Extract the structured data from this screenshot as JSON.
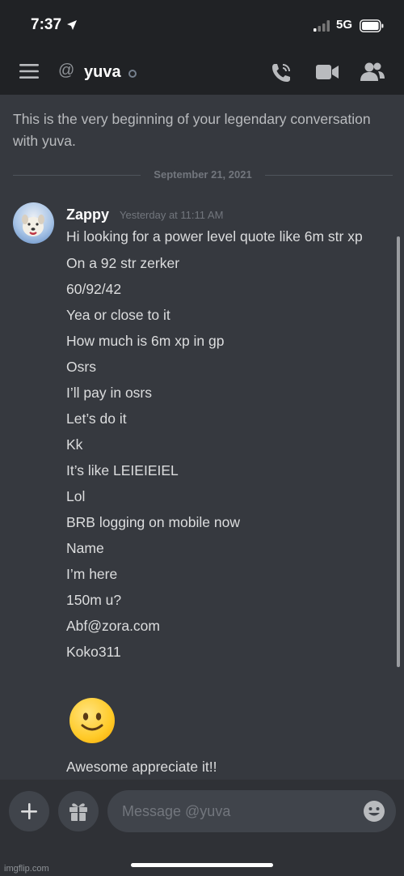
{
  "status_bar": {
    "time": "7:37",
    "network": "5G"
  },
  "header": {
    "channel_name": "yuva"
  },
  "intro_text": "This is the very beginning of your legendary conversation with yuva.",
  "divider_date": "September 21, 2021",
  "message_group": {
    "author": "Zappy",
    "timestamp": "Yesterday at 11:11 AM",
    "messages": [
      "Hi looking for a power level quote like 6m str xp",
      "On a 92 str zerker",
      "60/92/42",
      "Yea or close to it",
      "How much is 6m xp in gp",
      "Osrs",
      "I’ll pay in osrs",
      "Let’s do it",
      "Kk",
      "It’s like LEIEIEIEL",
      "Lol",
      "BRB logging on mobile now",
      "Name",
      "I’m here",
      "150m u?",
      "Abf@zora.com",
      "Koko311"
    ],
    "emoji_name": "slightly-smiling-face",
    "last_message": "Awesome appreciate it!!"
  },
  "composer": {
    "placeholder": "Message @yuva"
  },
  "watermark": "imgflip.com",
  "colors": {
    "background": "#36393f",
    "header": "#202225",
    "composer": "#2f3136",
    "input": "#40444b"
  }
}
